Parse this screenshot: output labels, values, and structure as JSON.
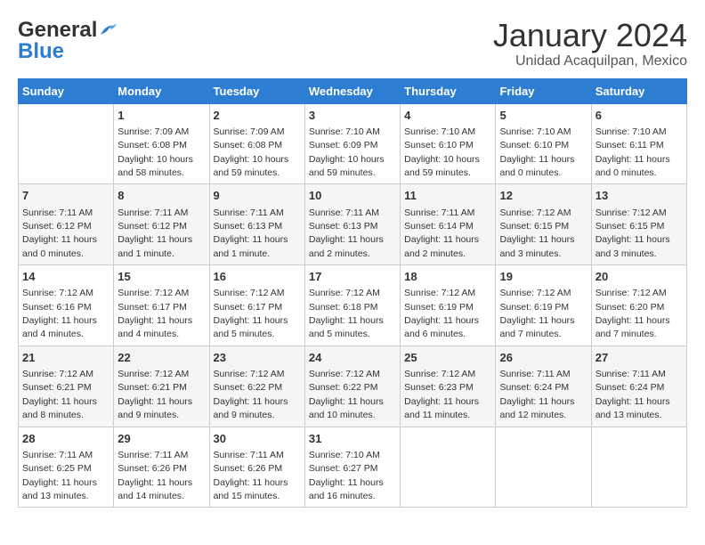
{
  "logo": {
    "line1": "General",
    "line2": "Blue"
  },
  "title": "January 2024",
  "subtitle": "Unidad Acaquilpan, Mexico",
  "headers": [
    "Sunday",
    "Monday",
    "Tuesday",
    "Wednesday",
    "Thursday",
    "Friday",
    "Saturday"
  ],
  "weeks": [
    [
      {
        "day": "",
        "sunrise": "",
        "sunset": "",
        "daylight": ""
      },
      {
        "day": "1",
        "sunrise": "Sunrise: 7:09 AM",
        "sunset": "Sunset: 6:08 PM",
        "daylight": "Daylight: 10 hours and 58 minutes."
      },
      {
        "day": "2",
        "sunrise": "Sunrise: 7:09 AM",
        "sunset": "Sunset: 6:08 PM",
        "daylight": "Daylight: 10 hours and 59 minutes."
      },
      {
        "day": "3",
        "sunrise": "Sunrise: 7:10 AM",
        "sunset": "Sunset: 6:09 PM",
        "daylight": "Daylight: 10 hours and 59 minutes."
      },
      {
        "day": "4",
        "sunrise": "Sunrise: 7:10 AM",
        "sunset": "Sunset: 6:10 PM",
        "daylight": "Daylight: 10 hours and 59 minutes."
      },
      {
        "day": "5",
        "sunrise": "Sunrise: 7:10 AM",
        "sunset": "Sunset: 6:10 PM",
        "daylight": "Daylight: 11 hours and 0 minutes."
      },
      {
        "day": "6",
        "sunrise": "Sunrise: 7:10 AM",
        "sunset": "Sunset: 6:11 PM",
        "daylight": "Daylight: 11 hours and 0 minutes."
      }
    ],
    [
      {
        "day": "7",
        "sunrise": "Sunrise: 7:11 AM",
        "sunset": "Sunset: 6:12 PM",
        "daylight": "Daylight: 11 hours and 0 minutes."
      },
      {
        "day": "8",
        "sunrise": "Sunrise: 7:11 AM",
        "sunset": "Sunset: 6:12 PM",
        "daylight": "Daylight: 11 hours and 1 minute."
      },
      {
        "day": "9",
        "sunrise": "Sunrise: 7:11 AM",
        "sunset": "Sunset: 6:13 PM",
        "daylight": "Daylight: 11 hours and 1 minute."
      },
      {
        "day": "10",
        "sunrise": "Sunrise: 7:11 AM",
        "sunset": "Sunset: 6:13 PM",
        "daylight": "Daylight: 11 hours and 2 minutes."
      },
      {
        "day": "11",
        "sunrise": "Sunrise: 7:11 AM",
        "sunset": "Sunset: 6:14 PM",
        "daylight": "Daylight: 11 hours and 2 minutes."
      },
      {
        "day": "12",
        "sunrise": "Sunrise: 7:12 AM",
        "sunset": "Sunset: 6:15 PM",
        "daylight": "Daylight: 11 hours and 3 minutes."
      },
      {
        "day": "13",
        "sunrise": "Sunrise: 7:12 AM",
        "sunset": "Sunset: 6:15 PM",
        "daylight": "Daylight: 11 hours and 3 minutes."
      }
    ],
    [
      {
        "day": "14",
        "sunrise": "Sunrise: 7:12 AM",
        "sunset": "Sunset: 6:16 PM",
        "daylight": "Daylight: 11 hours and 4 minutes."
      },
      {
        "day": "15",
        "sunrise": "Sunrise: 7:12 AM",
        "sunset": "Sunset: 6:17 PM",
        "daylight": "Daylight: 11 hours and 4 minutes."
      },
      {
        "day": "16",
        "sunrise": "Sunrise: 7:12 AM",
        "sunset": "Sunset: 6:17 PM",
        "daylight": "Daylight: 11 hours and 5 minutes."
      },
      {
        "day": "17",
        "sunrise": "Sunrise: 7:12 AM",
        "sunset": "Sunset: 6:18 PM",
        "daylight": "Daylight: 11 hours and 5 minutes."
      },
      {
        "day": "18",
        "sunrise": "Sunrise: 7:12 AM",
        "sunset": "Sunset: 6:19 PM",
        "daylight": "Daylight: 11 hours and 6 minutes."
      },
      {
        "day": "19",
        "sunrise": "Sunrise: 7:12 AM",
        "sunset": "Sunset: 6:19 PM",
        "daylight": "Daylight: 11 hours and 7 minutes."
      },
      {
        "day": "20",
        "sunrise": "Sunrise: 7:12 AM",
        "sunset": "Sunset: 6:20 PM",
        "daylight": "Daylight: 11 hours and 7 minutes."
      }
    ],
    [
      {
        "day": "21",
        "sunrise": "Sunrise: 7:12 AM",
        "sunset": "Sunset: 6:21 PM",
        "daylight": "Daylight: 11 hours and 8 minutes."
      },
      {
        "day": "22",
        "sunrise": "Sunrise: 7:12 AM",
        "sunset": "Sunset: 6:21 PM",
        "daylight": "Daylight: 11 hours and 9 minutes."
      },
      {
        "day": "23",
        "sunrise": "Sunrise: 7:12 AM",
        "sunset": "Sunset: 6:22 PM",
        "daylight": "Daylight: 11 hours and 9 minutes."
      },
      {
        "day": "24",
        "sunrise": "Sunrise: 7:12 AM",
        "sunset": "Sunset: 6:22 PM",
        "daylight": "Daylight: 11 hours and 10 minutes."
      },
      {
        "day": "25",
        "sunrise": "Sunrise: 7:12 AM",
        "sunset": "Sunset: 6:23 PM",
        "daylight": "Daylight: 11 hours and 11 minutes."
      },
      {
        "day": "26",
        "sunrise": "Sunrise: 7:11 AM",
        "sunset": "Sunset: 6:24 PM",
        "daylight": "Daylight: 11 hours and 12 minutes."
      },
      {
        "day": "27",
        "sunrise": "Sunrise: 7:11 AM",
        "sunset": "Sunset: 6:24 PM",
        "daylight": "Daylight: 11 hours and 13 minutes."
      }
    ],
    [
      {
        "day": "28",
        "sunrise": "Sunrise: 7:11 AM",
        "sunset": "Sunset: 6:25 PM",
        "daylight": "Daylight: 11 hours and 13 minutes."
      },
      {
        "day": "29",
        "sunrise": "Sunrise: 7:11 AM",
        "sunset": "Sunset: 6:26 PM",
        "daylight": "Daylight: 11 hours and 14 minutes."
      },
      {
        "day": "30",
        "sunrise": "Sunrise: 7:11 AM",
        "sunset": "Sunset: 6:26 PM",
        "daylight": "Daylight: 11 hours and 15 minutes."
      },
      {
        "day": "31",
        "sunrise": "Sunrise: 7:10 AM",
        "sunset": "Sunset: 6:27 PM",
        "daylight": "Daylight: 11 hours and 16 minutes."
      },
      {
        "day": "",
        "sunrise": "",
        "sunset": "",
        "daylight": ""
      },
      {
        "day": "",
        "sunrise": "",
        "sunset": "",
        "daylight": ""
      },
      {
        "day": "",
        "sunrise": "",
        "sunset": "",
        "daylight": ""
      }
    ]
  ]
}
